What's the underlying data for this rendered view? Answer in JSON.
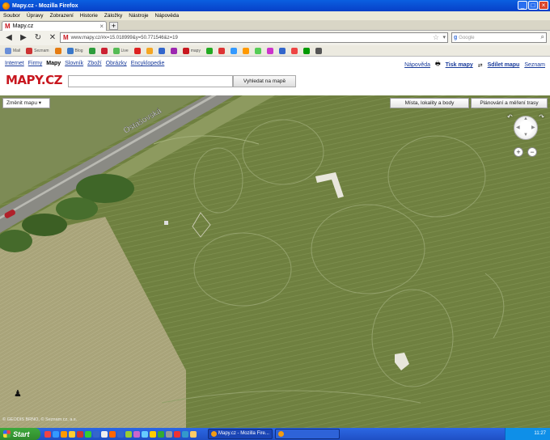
{
  "window": {
    "title": "Mapy.cz - Mozilla Firefox"
  },
  "menu": [
    "Soubor",
    "Úpravy",
    "Zobrazení",
    "Historie",
    "Záložky",
    "Nástroje",
    "Nápověda"
  ],
  "tab": {
    "label": "Mapy.cz"
  },
  "address": {
    "url": "www.mapy.cz/#x=15.018999&y=50.771546&z=19"
  },
  "search_engine": {
    "placeholder": "Google"
  },
  "bookmarks": [
    {
      "label": "Mail",
      "color": "#6a8fd8"
    },
    {
      "label": "Seznam",
      "color": "#c33"
    },
    {
      "label": "",
      "color": "#e57c12"
    },
    {
      "label": "Blog",
      "color": "#3a78c9"
    },
    {
      "label": "",
      "color": "#2d9c3c"
    },
    {
      "label": "",
      "color": "#c23"
    },
    {
      "label": "Live",
      "color": "#5b5"
    },
    {
      "label": "",
      "color": "#d22"
    },
    {
      "label": "",
      "color": "#f5a623"
    },
    {
      "label": "",
      "color": "#36c"
    },
    {
      "label": "",
      "color": "#9c27b0"
    },
    {
      "label": "mapy",
      "color": "#c8171f"
    },
    {
      "label": "",
      "color": "#2a2"
    },
    {
      "label": "",
      "color": "#d33"
    },
    {
      "label": "",
      "color": "#39f"
    },
    {
      "label": "",
      "color": "#f90"
    },
    {
      "label": "",
      "color": "#5c5"
    },
    {
      "label": "",
      "color": "#c3c"
    },
    {
      "label": "",
      "color": "#36c"
    },
    {
      "label": "",
      "color": "#e44"
    },
    {
      "label": "",
      "color": "#090"
    },
    {
      "label": "",
      "color": "#555"
    }
  ],
  "page": {
    "nav": [
      {
        "label": "Internet",
        "active": false
      },
      {
        "label": "Firmy",
        "active": false
      },
      {
        "label": "Mapy",
        "active": true
      },
      {
        "label": "Slovník",
        "active": false
      },
      {
        "label": "Zboží",
        "active": false
      },
      {
        "label": "Obrázky",
        "active": false
      },
      {
        "label": "Encyklopedie",
        "active": false
      }
    ],
    "right_nav": {
      "help": "Nápověda",
      "print": "Tisk mapy",
      "share": "Sdílet mapu",
      "seznam": "Seznam"
    },
    "logo": "MAPY.CZ",
    "search": {
      "value": "",
      "button": "Vyhledat na mapě"
    }
  },
  "map": {
    "change_map": "Změnit mapu",
    "places_button": "Místa, lokality a body",
    "route_button": "Plánování a měření trasy",
    "road_label": "Ostašovská",
    "copyright": "© GEODIS BRNO, © Seznam.cz, a.s."
  },
  "taskbar": {
    "start": "Start",
    "task_active": "Mapy.cz - Mozilla Fire...",
    "task_other": "",
    "clock": "11:27"
  }
}
